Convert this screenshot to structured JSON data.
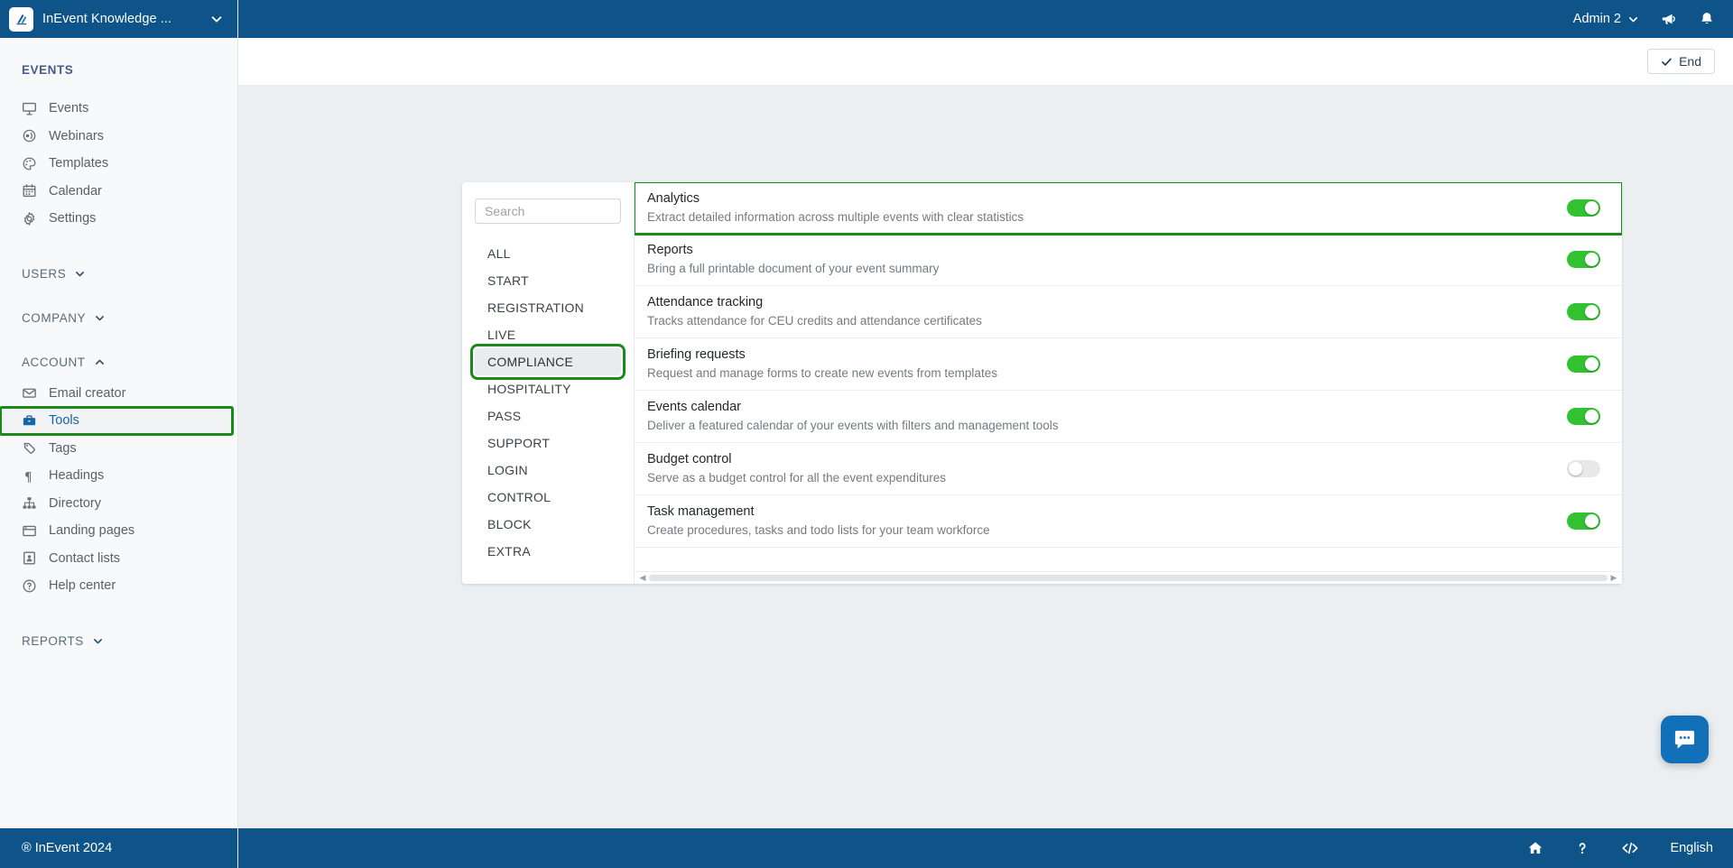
{
  "brand": {
    "title": "InEvent Knowledge ...",
    "logo_icon": "inevent-logo-icon",
    "caret_icon": "chevron-down-icon"
  },
  "topbar": {
    "admin_label": "Admin 2",
    "admin_caret_icon": "chevron-down-icon",
    "megaphone_icon": "megaphone-icon",
    "bell_icon": "bell-icon"
  },
  "subbar": {
    "end_label": "End",
    "end_check_icon": "check-icon"
  },
  "sidebar": {
    "sections": [
      {
        "title": "EVENTS",
        "collapsible": false,
        "items": [
          {
            "label": "Events",
            "icon": "presentation-screen-icon"
          },
          {
            "label": "Webinars",
            "icon": "webinar-icon"
          },
          {
            "label": "Templates",
            "icon": "palette-icon"
          },
          {
            "label": "Calendar",
            "icon": "calendar-icon"
          },
          {
            "label": "Settings",
            "icon": "gear-icon"
          }
        ]
      },
      {
        "title": "USERS",
        "collapsible": true,
        "expanded": false,
        "caret_icon": "chevron-down-icon",
        "items": []
      },
      {
        "title": "COMPANY",
        "collapsible": true,
        "expanded": false,
        "caret_icon": "chevron-down-icon",
        "items": []
      },
      {
        "title": "ACCOUNT",
        "collapsible": true,
        "expanded": true,
        "caret_icon": "chevron-up-icon",
        "items": [
          {
            "label": "Email creator",
            "icon": "envelope-icon"
          },
          {
            "label": "Tools",
            "icon": "toolbox-icon",
            "active": true,
            "highlighted": true
          },
          {
            "label": "Tags",
            "icon": "tag-icon"
          },
          {
            "label": "Headings",
            "icon": "paragraph-icon"
          },
          {
            "label": "Directory",
            "icon": "sitemap-icon"
          },
          {
            "label": "Landing pages",
            "icon": "browser-window-icon"
          },
          {
            "label": "Contact lists",
            "icon": "contact-card-icon"
          },
          {
            "label": "Help center",
            "icon": "question-circle-icon"
          }
        ]
      },
      {
        "title": "REPORTS",
        "collapsible": true,
        "expanded": false,
        "caret_icon": "chevron-down-icon",
        "items": []
      }
    ],
    "footer": "® InEvent 2024"
  },
  "panel": {
    "search": {
      "placeholder": "Search",
      "value": ""
    },
    "categories": [
      {
        "label": "ALL"
      },
      {
        "label": "START"
      },
      {
        "label": "REGISTRATION"
      },
      {
        "label": "LIVE"
      },
      {
        "label": "COMPLIANCE",
        "active": true,
        "highlighted": true
      },
      {
        "label": "HOSPITALITY"
      },
      {
        "label": "PASS"
      },
      {
        "label": "SUPPORT"
      },
      {
        "label": "LOGIN"
      },
      {
        "label": "CONTROL"
      },
      {
        "label": "BLOCK"
      },
      {
        "label": "EXTRA"
      }
    ],
    "tools": [
      {
        "title": "Analytics",
        "description": "Extract detailed information across multiple events with clear statistics",
        "enabled": true,
        "highlighted": true
      },
      {
        "title": "Reports",
        "description": "Bring a full printable document of your event summary",
        "enabled": true
      },
      {
        "title": "Attendance tracking",
        "description": "Tracks attendance for CEU credits and attendance certificates",
        "enabled": true
      },
      {
        "title": "Briefing requests",
        "description": "Request and manage forms to create new events from templates",
        "enabled": true
      },
      {
        "title": "Events calendar",
        "description": "Deliver a featured calendar of your events with filters and management tools",
        "enabled": true
      },
      {
        "title": "Budget control",
        "description": "Serve as a budget control for all the event expenditures",
        "enabled": false
      },
      {
        "title": "Task management",
        "description": "Create procedures, tasks and todo lists for your team workforce",
        "enabled": true
      }
    ],
    "scrollbar": {
      "left_arrow": "◀",
      "right_arrow": "▶"
    }
  },
  "chat": {
    "icon": "chat-bubble-icon"
  },
  "bottombar": {
    "home_icon": "home-icon",
    "help_icon": "question-mark-icon",
    "code_icon": "code-brackets-icon",
    "language_label": "English"
  },
  "colors": {
    "brand_blue": "#0e5489",
    "accent_green": "#31c131",
    "highlight_green": "#1a8b1a",
    "content_bg": "#eceff1",
    "sidebar_bg": "#f7f9fa"
  }
}
